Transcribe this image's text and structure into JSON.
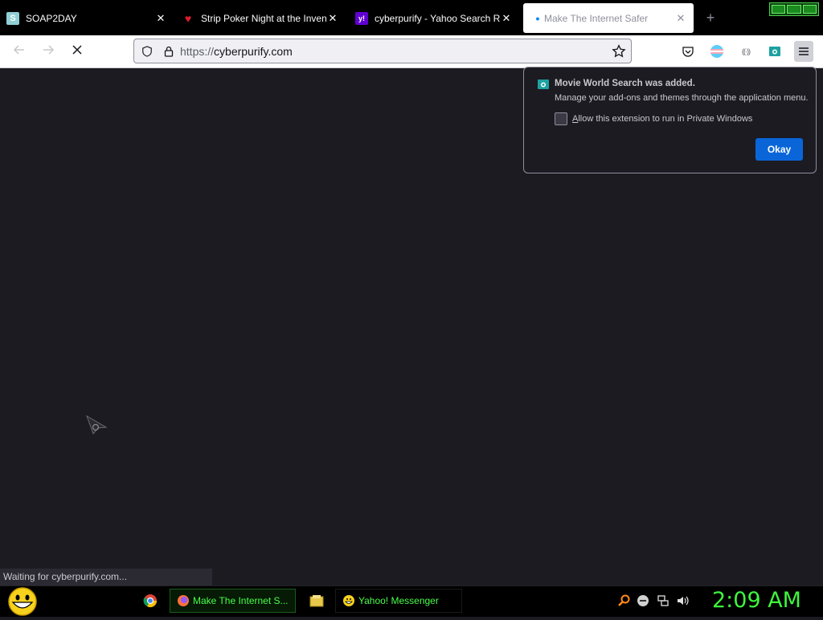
{
  "tabs": [
    {
      "title": "SOAP2DAY",
      "favicon": "S",
      "favicon_color": "#8fd0d6",
      "icon_name": "soap2day-favicon"
    },
    {
      "title": "Strip Poker Night at the Invent",
      "favicon": "♥",
      "favicon_color": "#e01b2e",
      "icon_name": "heart-icon"
    },
    {
      "title": "cyberpurify - Yahoo Search Re",
      "favicon": "y!",
      "favicon_color": "#6001d2",
      "icon_name": "yahoo-icon"
    },
    {
      "title": "Make The Internet Safer",
      "favicon": "•",
      "favicon_color": "#0a84ff",
      "icon_name": "loading-icon",
      "active": true
    }
  ],
  "urlbar": {
    "protocol": "https://",
    "domain": "cyberpurify.com"
  },
  "status_text": "Waiting for cyberpurify.com...",
  "popup": {
    "title": "Movie World Search was added.",
    "description": "Manage your add-ons and themes through the application menu.",
    "checkbox_label": "Allow this extension to run in Private Windows",
    "checkbox_accesskey": "A",
    "button_label": "Okay"
  },
  "taskbar": {
    "tasks": [
      {
        "label": "Make The Internet S...",
        "icon_name": "firefox-icon"
      },
      {
        "label": "Yahoo! Messenger",
        "icon_name": "yahoo-messenger-icon"
      }
    ],
    "clock": "2:09 AM"
  },
  "colors": {
    "accent": "#0a66d8",
    "taskbar_text": "#4aff4a",
    "clock": "#3ef53e"
  }
}
